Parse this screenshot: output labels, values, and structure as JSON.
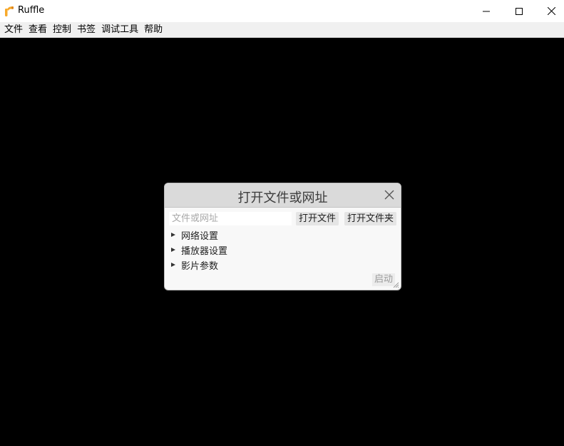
{
  "window": {
    "title": "Ruffle",
    "brand_color": "#f7a92b"
  },
  "menu": {
    "items": [
      "文件",
      "查看",
      "控制",
      "书签",
      "调试工具",
      "帮助"
    ]
  },
  "dialog": {
    "title": "打开文件或网址",
    "input_placeholder": "文件或网址",
    "input_value": "",
    "open_file_label": "打开文件",
    "open_folder_label": "打开文件夹",
    "sections": [
      "网络设置",
      "播放器设置",
      "影片参数"
    ],
    "launch_label": "启动"
  }
}
